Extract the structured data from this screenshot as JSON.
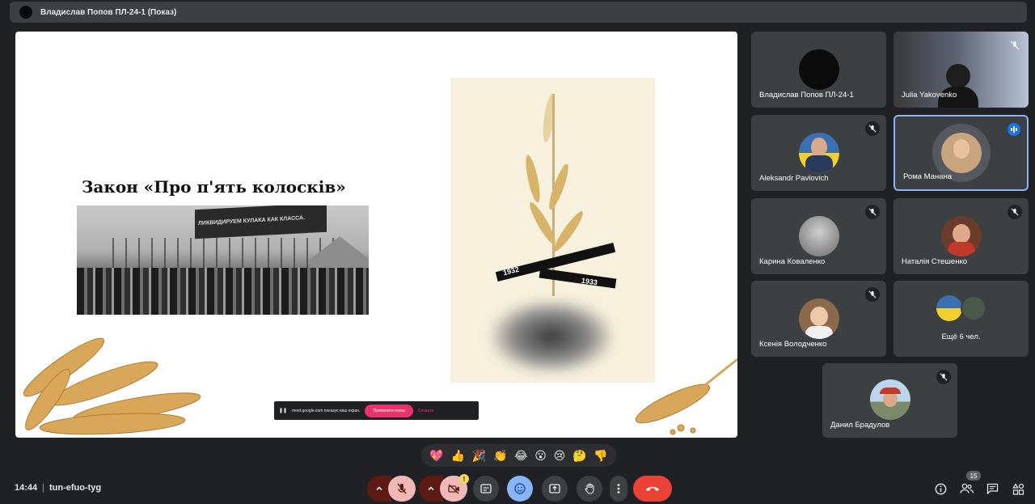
{
  "presenter_bar": {
    "title": "Владислав Попов ПЛ-24-1 (Показ)"
  },
  "slide": {
    "title": "Закон «Про п'ять колосків»",
    "banner_text": "ЛИКВИДИРУЕМ КУЛАКА КАК КЛАССА.",
    "year_left": "1932",
    "year_right": "1933"
  },
  "share_notice": {
    "text": "meet.google.com показує ваш екран.",
    "stop_label": "Припинити показ",
    "hide_label": "Сховати"
  },
  "participants": [
    {
      "name": "Владислав Попов ПЛ-24-1",
      "avatar_color": "#0b0b0b"
    },
    {
      "name": "Julia Yakovenko",
      "avatar_color": "#7a8aa0"
    },
    {
      "name": "Aleksandr Pavlovich",
      "avatar_color": "#4a6fb0"
    },
    {
      "name": "Рома Манана",
      "avatar_color": "#c9a57f"
    },
    {
      "name": "Карина Коваленко",
      "avatar_color": "#9a9a9a"
    },
    {
      "name": "Наталія Стешенко",
      "avatar_color": "#b5543a"
    },
    {
      "name": "Ксенія Володченко",
      "avatar_color": "#c58e5e"
    },
    {
      "name": "Ещё 6 чел.",
      "avatar_color": "#3a6fb0"
    },
    {
      "name": "Данил Брадулов",
      "avatar_color": "#8ab0d0"
    }
  ],
  "reactions": [
    "💖",
    "👍",
    "🎉",
    "👏",
    "😂",
    "😮",
    "😢",
    "🤔",
    "👎"
  ],
  "bottom_bar": {
    "time": "14:44",
    "meeting_code": "tun-efuo-tyg",
    "camera_warning": "!",
    "participants_count": "15"
  },
  "colors": {
    "background": "#202124",
    "tile": "#3c4043",
    "end_call": "#ea4335",
    "active_border": "#8ab4f8"
  }
}
